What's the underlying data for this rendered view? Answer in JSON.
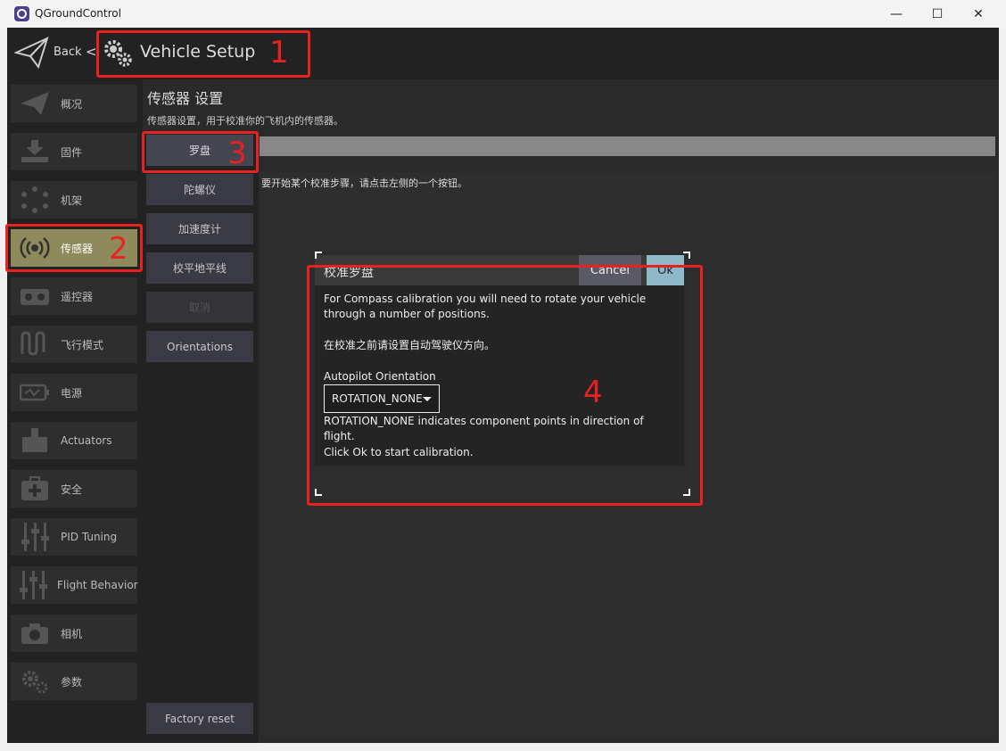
{
  "window": {
    "title": "QGroundControl",
    "minimize": "—",
    "maximize": "☐",
    "close": "✕"
  },
  "topbar": {
    "back_label": "Back",
    "back_chevron": "<",
    "title": "Vehicle Setup"
  },
  "sidebar": {
    "items": [
      {
        "label": "概况",
        "icon": "plane-icon"
      },
      {
        "label": "固件",
        "icon": "firmware-download-icon"
      },
      {
        "label": "机架",
        "icon": "airframe-icon"
      },
      {
        "label": "传感器",
        "icon": "sensors-icon",
        "active": true
      },
      {
        "label": "遥控器",
        "icon": "radio-icon"
      },
      {
        "label": "飞行模式",
        "icon": "flight-modes-icon"
      },
      {
        "label": "电源",
        "icon": "battery-icon"
      },
      {
        "label": "Actuators",
        "icon": "actuators-icon"
      },
      {
        "label": "安全",
        "icon": "safety-icon"
      },
      {
        "label": "PID Tuning",
        "icon": "sliders-icon"
      },
      {
        "label": "Flight Behavior",
        "icon": "sliders-icon"
      },
      {
        "label": "相机",
        "icon": "camera-icon"
      },
      {
        "label": "参数",
        "icon": "gears-icon"
      }
    ]
  },
  "sensors": {
    "title": "传感器 设置",
    "description": "传感器设置，用于校准你的飞机内的传感器。",
    "buttons": [
      {
        "label": "罗盘",
        "state": "selected"
      },
      {
        "label": "陀螺仪"
      },
      {
        "label": "加速度计"
      },
      {
        "label": "校平地平线"
      },
      {
        "label": "取消",
        "state": "disabled"
      },
      {
        "label": "Orientations"
      }
    ],
    "factory_reset": "Factory reset",
    "hint": "要开始某个校准步骤，请点击左侧的一个按钮。"
  },
  "dialog": {
    "title": "校准罗盘",
    "cancel": "Cancel",
    "ok": "Ok",
    "line1": "For Compass calibration you will need to rotate your vehicle through a number of positions.",
    "line2": "在校准之前请设置自动驾驶仪方向。",
    "orientation_label": "Autopilot Orientation",
    "orientation_value": "ROTATION_NONE",
    "orientation_note": "ROTATION_NONE indicates component points in direction of flight.",
    "footer": "Click Ok to start calibration."
  },
  "annotations": [
    "1",
    "2",
    "3",
    "4"
  ],
  "colors": {
    "annotation": "#e8231f",
    "active_item": "#8f8a5b",
    "ok_button": "#8fb8c8"
  }
}
